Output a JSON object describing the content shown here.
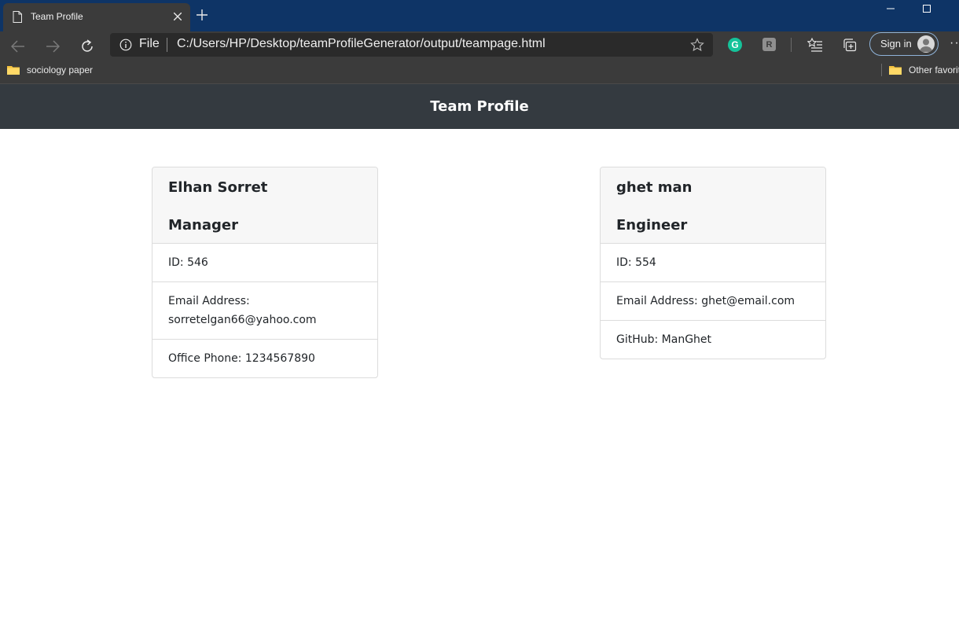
{
  "browser": {
    "tab_title": "Team Profile",
    "address_scheme": "File",
    "url": "C:/Users/HP/Desktop/teamProfileGenerator/output/teampage.html",
    "grammarly_glyph": "G",
    "extension_glyph": "R",
    "sign_in_label": "Sign in",
    "more_glyph": "···",
    "favorites": [
      {
        "label": "sociology paper",
        "icon": "folder-icon"
      },
      {
        "label": "Other favorit",
        "icon": "folder-icon"
      }
    ],
    "colors": {
      "titlebar": "#0e3466",
      "toolbar": "#3b3b3b",
      "signin_border": "#8fb3d9",
      "grammarly": "#15c39a"
    }
  },
  "page": {
    "header_title": "Team Profile",
    "header_color": "#343a40",
    "cards": [
      {
        "name": "Elhan Sorret",
        "role": "Manager",
        "id": "ID: 546",
        "email": "Email Address: sorretelgan66@yahoo.com",
        "extra": "Office Phone: 1234567890"
      },
      {
        "name": "ghet man",
        "role": "Engineer",
        "id": "ID: 554",
        "email": "Email Address: ghet@email.com",
        "extra": "GitHub: ManGhet"
      }
    ]
  }
}
